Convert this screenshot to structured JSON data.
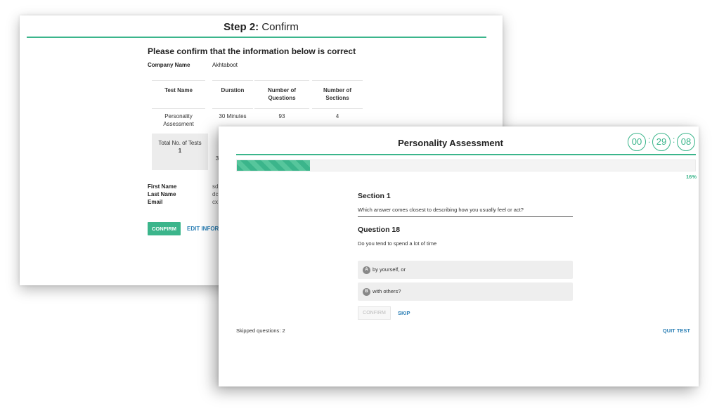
{
  "confirm_page": {
    "title_step": "Step 2:",
    "title_text": "Confirm",
    "heading": "Please confirm that the information below is correct",
    "company_label": "Company Name",
    "company_value": "Akhtaboot",
    "table": {
      "headers": [
        "Test Name",
        "Duration",
        "Number of Questions",
        "Number of Sections"
      ],
      "row": [
        "Personality Assessment",
        "30 Minutes",
        "93",
        "4"
      ],
      "total_label": "Total No. of Tests",
      "total_value": "1",
      "total_partial": "3"
    },
    "first_name_label": "First Name",
    "first_name_value": "sd",
    "last_name_label": "Last Name",
    "last_name_value": "dc",
    "email_label": "Email",
    "email_value": "cx",
    "confirm_button": "CONFIRM",
    "edit_link": "EDIT INFORM"
  },
  "assessment": {
    "title": "Personality Assessment",
    "timer": {
      "hours": "00",
      "minutes": "29",
      "seconds": "08",
      "separator": ":"
    },
    "progress_percent": 16,
    "progress_label": "16%",
    "section_title": "Section 1",
    "section_description": "Which answer comes closest to describing how you usually feel or act?",
    "question_title": "Question 18",
    "question_text": "Do you tend to spend a lot of time",
    "options": [
      {
        "letter": "A",
        "text": "by yourself, or"
      },
      {
        "letter": "B",
        "text": "with others?"
      }
    ],
    "confirm_button": "CONFIRM",
    "skip_link": "SKIP",
    "skipped_text": "Skipped questions: 2",
    "quit_link": "QUIT TEST"
  },
  "colors": {
    "accent": "#3bb58b",
    "link": "#2b7fb5"
  }
}
